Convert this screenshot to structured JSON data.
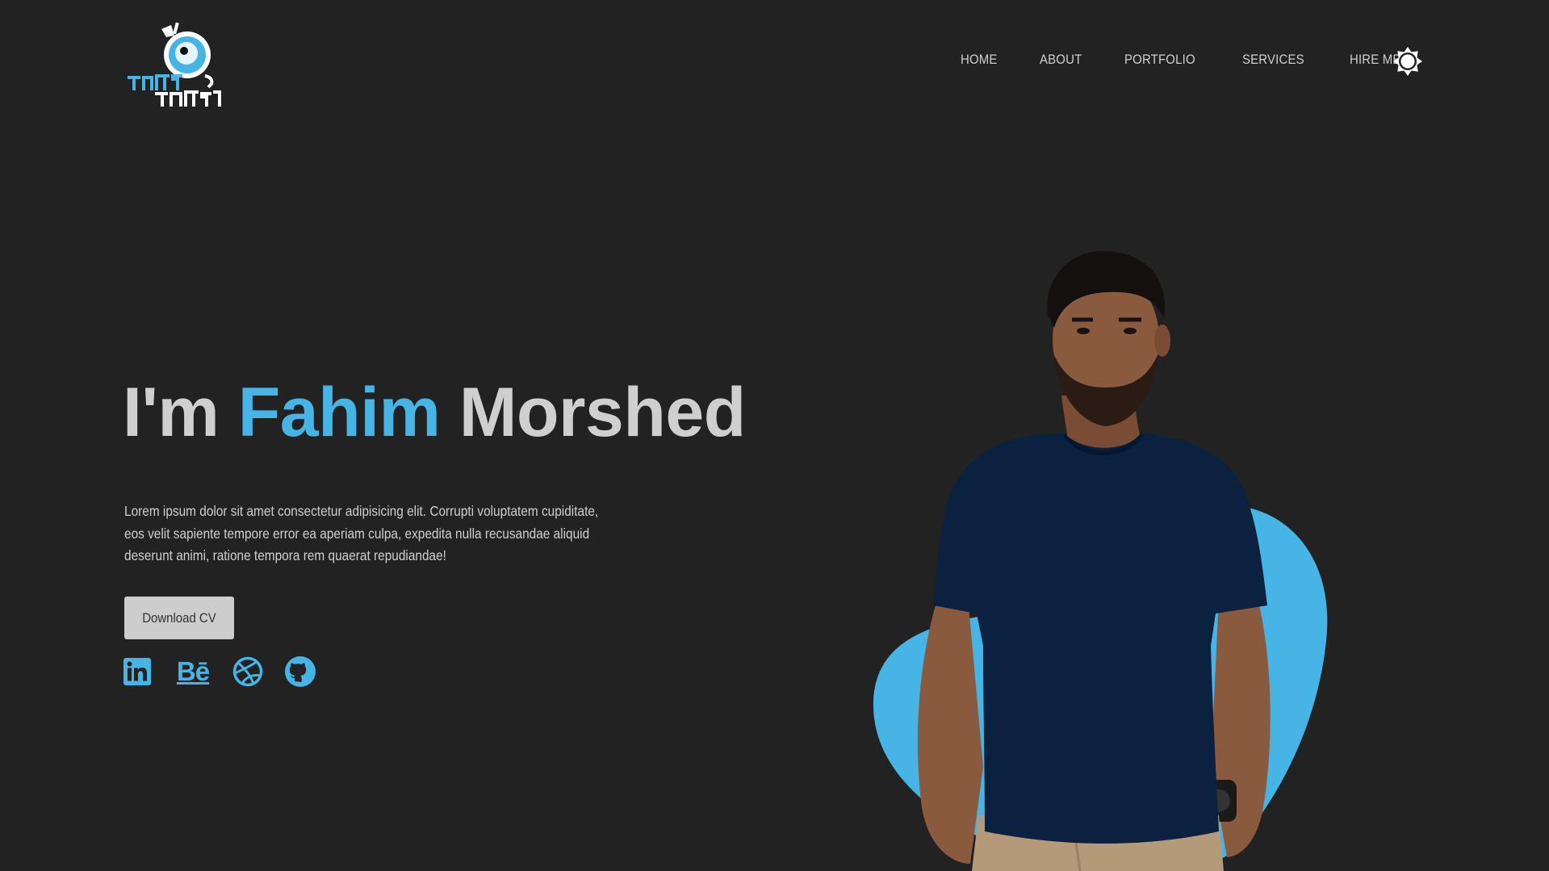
{
  "logo": {
    "alt_text": "ফাহিম মোর্শেদ"
  },
  "nav": {
    "items": [
      {
        "label": "HOME"
      },
      {
        "label": "ABOUT"
      },
      {
        "label": "PORTFOLIO"
      },
      {
        "label": "SERVICES"
      },
      {
        "label": "HIRE ME"
      }
    ],
    "theme_toggle_icon": "sun-icon"
  },
  "hero": {
    "title_prefix": "I'm",
    "first_name": "Fahim",
    "last_name": "Morshed",
    "description": "Lorem ipsum dolor sit amet consectetur adipisicing elit. Corrupti voluptatem cupiditate, eos velit sapiente tempore error ea aperiam culpa, expedita nulla recusandae aliquid deserunt animi, ratione tempora rem quaerat repudiandae!",
    "cv_button_label": "Download CV"
  },
  "socials": [
    {
      "icon": "linkedin-icon"
    },
    {
      "icon": "behance-icon",
      "text": "Bē"
    },
    {
      "icon": "dribbble-icon"
    },
    {
      "icon": "github-icon"
    }
  ],
  "colors": {
    "background": "#222222",
    "accent": "#47b4e6",
    "text": "#cfcfcf",
    "button_bg": "#cdcdcd",
    "shirt": "#0b2140"
  }
}
